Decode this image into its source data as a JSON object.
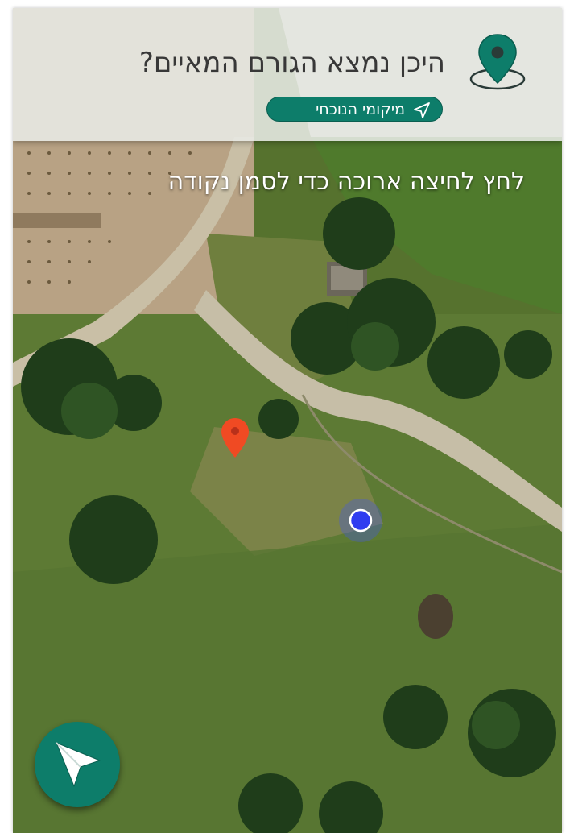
{
  "header": {
    "question": "היכן נמצא הגורם המאיים?",
    "location_button_label": "מיקומי הנוכחי"
  },
  "map": {
    "hint": "לחץ לחיצה ארוכה כדי לסמן נקודה",
    "view": "satellite",
    "marker_color": "#f04a23",
    "user_location_color": "#2f3df0"
  },
  "colors": {
    "accent": "#0d7d6a",
    "header_background": "#e8ebe6"
  },
  "icons": {
    "header_icon": "location-pin-icon",
    "location_button_icon": "navigation-arrow-icon",
    "fab_icon": "send-arrow-icon"
  }
}
